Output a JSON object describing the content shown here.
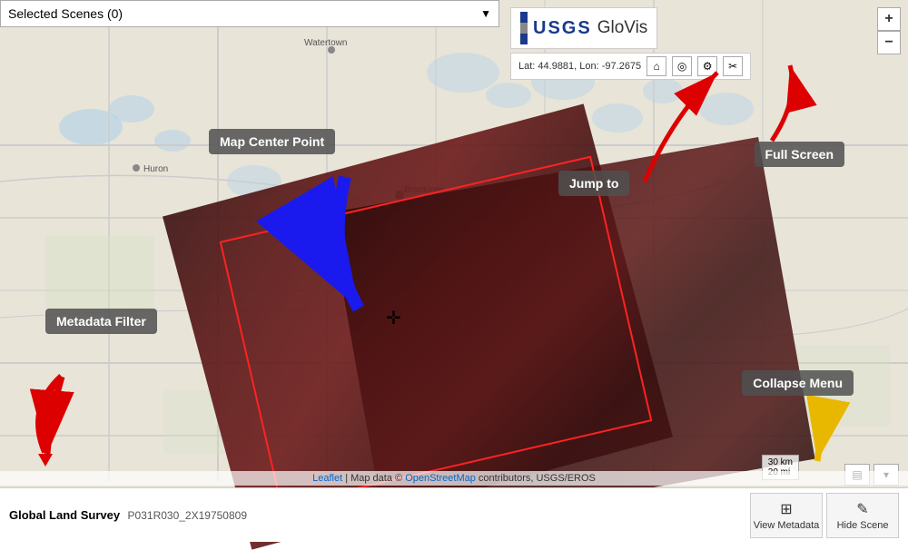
{
  "header": {
    "selected_scenes_label": "Selected Scenes (0)",
    "dropdown_arrow": "▼"
  },
  "usgs": {
    "logo_text": "USGS",
    "glovis_text": "GloVis"
  },
  "coords": {
    "lat_lon": "Lat: 44.9881, Lon: -97.2675"
  },
  "zoom": {
    "plus": "+",
    "minus": "−"
  },
  "annotations": {
    "map_center_point": "Map Center Point",
    "jump_to": "Jump to",
    "full_screen": "Full Screen",
    "metadata_filter": "Metadata Filter",
    "collapse_menu": "Collapse Menu"
  },
  "bottom_bar": {
    "label": "Global Land Survey",
    "scene_id": "P031R030_2X19750809"
  },
  "buttons": {
    "view_metadata": "View Metadata",
    "hide_scene": "Hide Scene"
  },
  "attribution": {
    "leaflet": "Leaflet",
    "map_data": "| Map data © ",
    "osm": "OpenStreetMap",
    "contributors": " contributors, USGS/EROS"
  },
  "scale": {
    "km": "30 km",
    "mi": "20 mi"
  },
  "icons": {
    "home": "⌂",
    "location": "◉",
    "gear": "⚙",
    "tools": "✂",
    "grid": "⊞",
    "pencil": "✎",
    "move": "✛",
    "print": "▤",
    "expand": "▾"
  }
}
